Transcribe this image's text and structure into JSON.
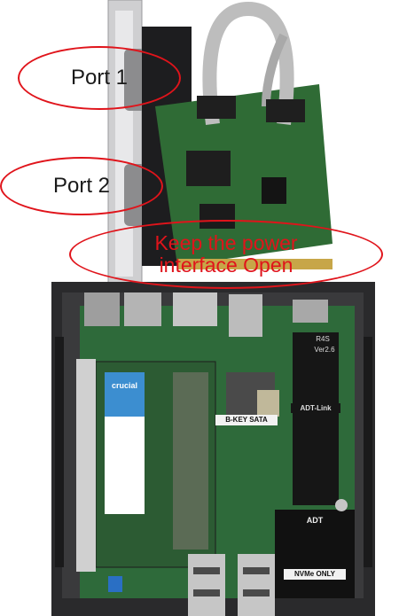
{
  "image": {
    "kind": "photo",
    "subject": "open mini PC with serial-port expansion card",
    "colors": {
      "board_green": "#2f6b35",
      "chassis": "#2a2a2c",
      "annotation_red": "#e0141b",
      "ribbon_cable": "#bdbdbd"
    }
  },
  "annotations": {
    "port1": "Port 1",
    "port2": "Port 2",
    "power_line1": "Keep the power",
    "power_line2": "interface Open"
  },
  "board_labels": {
    "ram_brand": "crucial",
    "b_key_sata": "B-KEY SATA",
    "adt_link": "ADT-Link",
    "nvme_only": "NVMe ONLY",
    "adt": "ADT",
    "r4s": "R4S",
    "ver": "Ver2.6"
  }
}
